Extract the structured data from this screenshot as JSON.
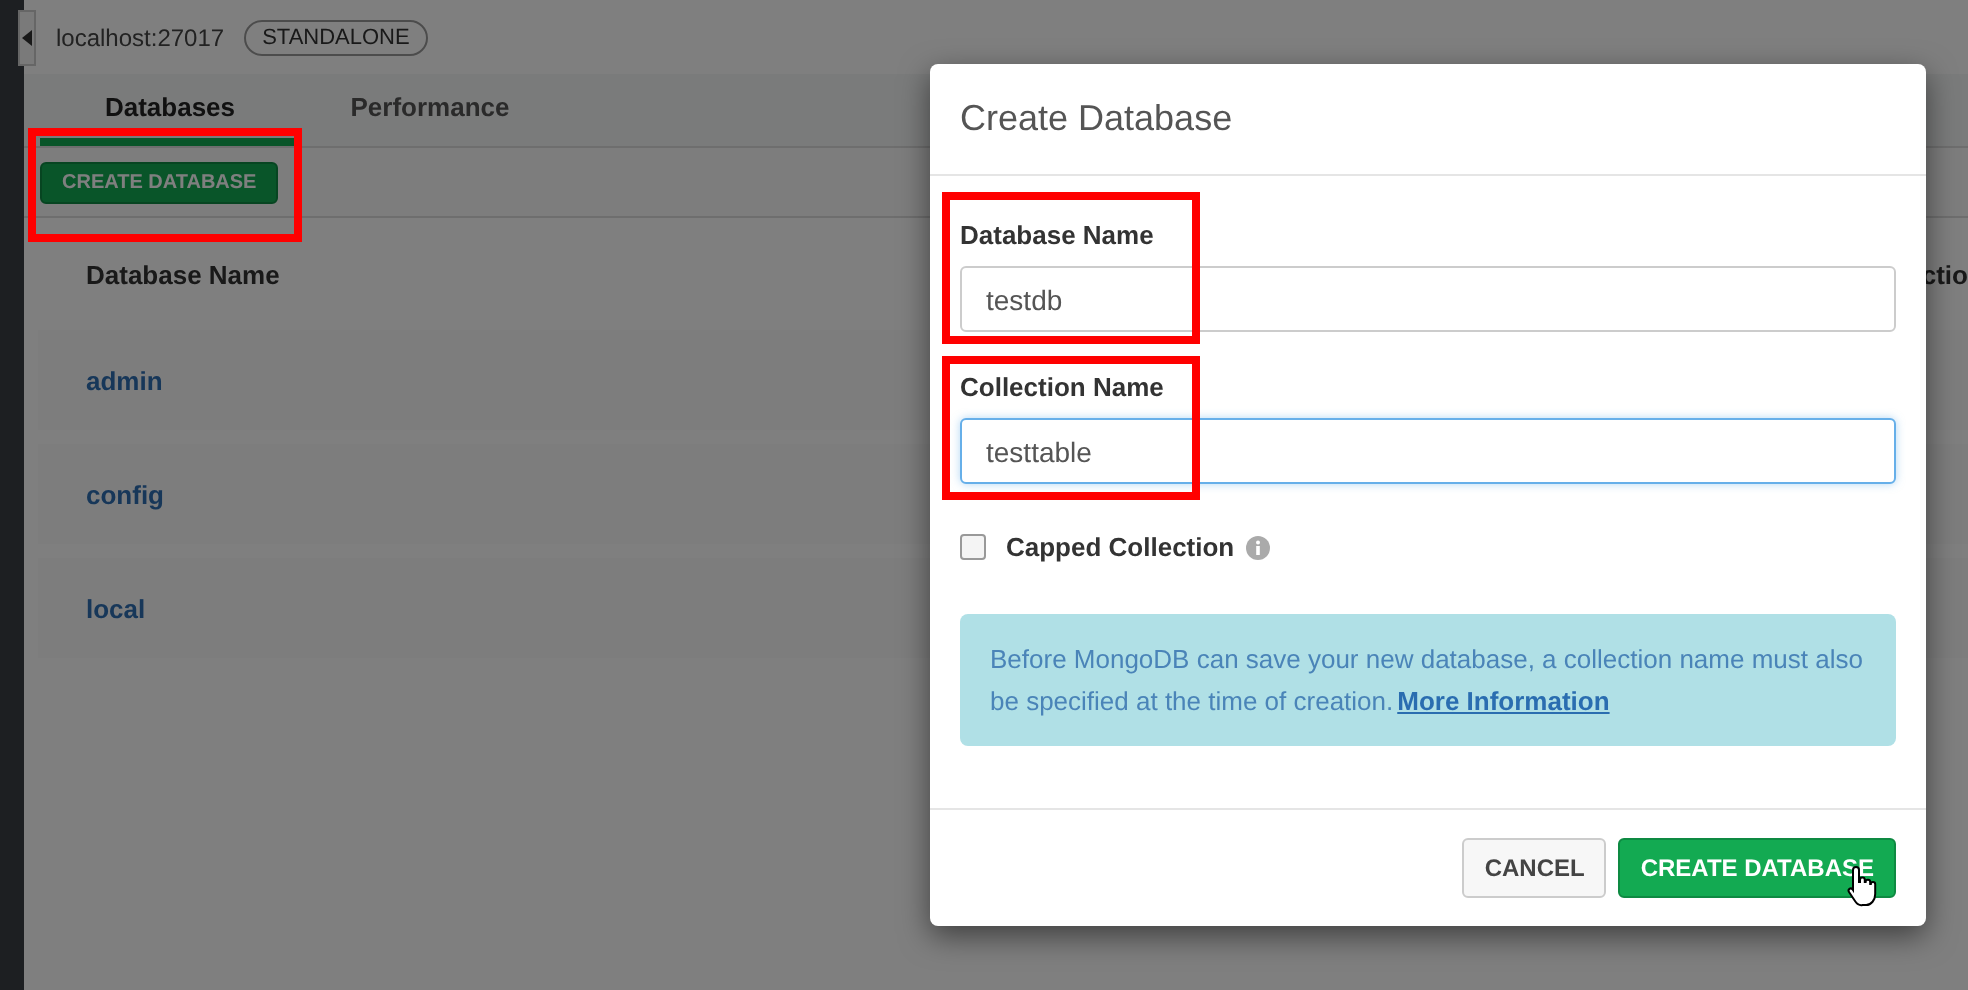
{
  "header": {
    "host": "localhost:27017",
    "badge": "STANDALONE"
  },
  "tabs": [
    {
      "label": "Databases",
      "selected": true
    },
    {
      "label": "Performance",
      "selected": false
    }
  ],
  "toolbar": {
    "create_button": "CREATE DATABASE"
  },
  "table": {
    "columns": [
      "Database Name",
      "ctio"
    ],
    "rows": [
      {
        "name": "admin"
      },
      {
        "name": "config"
      },
      {
        "name": "local"
      }
    ]
  },
  "dialog": {
    "title": "Create Database",
    "fields": [
      {
        "label": "Database Name",
        "value": "testdb",
        "focused": false
      },
      {
        "label": "Collection Name",
        "value": "testtable",
        "focused": true
      }
    ],
    "capped": {
      "label": "Capped Collection",
      "checked": false
    },
    "note": "Before MongoDB can save your new database, a collection name must also be specified at the time of creation.",
    "note_link": "More Information",
    "buttons": [
      {
        "label": "CANCEL",
        "kind": "secondary"
      },
      {
        "label": "CREATE DATABASE",
        "kind": "primary"
      }
    ]
  }
}
